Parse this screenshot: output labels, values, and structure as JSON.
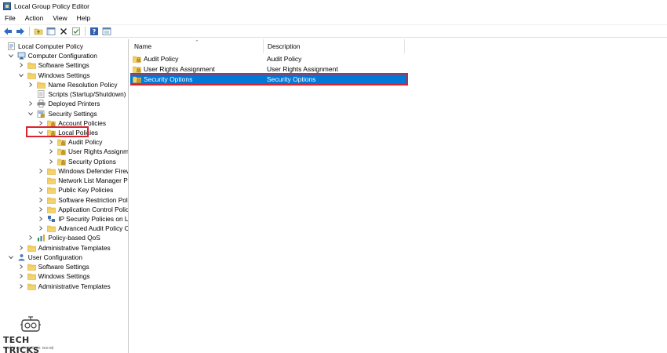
{
  "window": {
    "title": "Local Group Policy Editor"
  },
  "menu": [
    "File",
    "Action",
    "View",
    "Help"
  ],
  "toolbar": {
    "icons": [
      "back-arrow-icon",
      "forward-arrow-icon",
      "up-folder-icon",
      "show-hide-tree-icon",
      "delete-icon",
      "refresh-icon",
      "export-list-icon",
      "help-icon",
      "properties-icon"
    ]
  },
  "tree": [
    {
      "label": "Local Computer Policy",
      "icon": "policy-icon",
      "level": 0,
      "twisty": "none"
    },
    {
      "label": "Computer Configuration",
      "icon": "computer-icon",
      "level": 1,
      "twisty": "open"
    },
    {
      "label": "Software Settings",
      "icon": "folder-icon",
      "level": 2,
      "twisty": "closed"
    },
    {
      "label": "Windows Settings",
      "icon": "folder-icon",
      "level": 2,
      "twisty": "open"
    },
    {
      "label": "Name Resolution Policy",
      "icon": "folder-icon",
      "level": 3,
      "twisty": "closed"
    },
    {
      "label": "Scripts (Startup/Shutdown)",
      "icon": "script-icon",
      "level": 3,
      "twisty": "none"
    },
    {
      "label": "Deployed Printers",
      "icon": "printer-icon",
      "level": 3,
      "twisty": "closed"
    },
    {
      "label": "Security Settings",
      "icon": "security-icon",
      "level": 3,
      "twisty": "open"
    },
    {
      "label": "Account Policies",
      "icon": "locked-folder-icon",
      "level": 4,
      "twisty": "closed"
    },
    {
      "label": "Local Policies",
      "icon": "locked-folder-icon",
      "level": 4,
      "twisty": "open",
      "highlight": true
    },
    {
      "label": "Audit Policy",
      "icon": "locked-folder-icon",
      "level": 5,
      "twisty": "closed"
    },
    {
      "label": "User Rights Assignmer",
      "icon": "locked-folder-icon",
      "level": 5,
      "twisty": "closed"
    },
    {
      "label": "Security Options",
      "icon": "locked-folder-icon",
      "level": 5,
      "twisty": "closed"
    },
    {
      "label": "Windows Defender Firewa",
      "icon": "folder-icon",
      "level": 4,
      "twisty": "closed"
    },
    {
      "label": "Network List Manager Pol",
      "icon": "folder-icon",
      "level": 4,
      "twisty": "none"
    },
    {
      "label": "Public Key Policies",
      "icon": "folder-icon",
      "level": 4,
      "twisty": "closed"
    },
    {
      "label": "Software Restriction Polic",
      "icon": "folder-icon",
      "level": 4,
      "twisty": "closed"
    },
    {
      "label": "Application Control Polici",
      "icon": "folder-icon",
      "level": 4,
      "twisty": "closed"
    },
    {
      "label": "IP Security Policies on Loc",
      "icon": "ipsec-icon",
      "level": 4,
      "twisty": "closed"
    },
    {
      "label": "Advanced Audit Policy Co",
      "icon": "folder-icon",
      "level": 4,
      "twisty": "closed"
    },
    {
      "label": "Policy-based QoS",
      "icon": "qos-chart-icon",
      "level": 3,
      "twisty": "closed"
    },
    {
      "label": "Administrative Templates",
      "icon": "folder-icon",
      "level": 2,
      "twisty": "closed"
    },
    {
      "label": "User Configuration",
      "icon": "user-icon",
      "level": 1,
      "twisty": "open"
    },
    {
      "label": "Software Settings",
      "icon": "folder-icon",
      "level": 2,
      "twisty": "closed"
    },
    {
      "label": "Windows Settings",
      "icon": "folder-icon",
      "level": 2,
      "twisty": "closed"
    },
    {
      "label": "Administrative Templates",
      "icon": "folder-icon",
      "level": 2,
      "twisty": "closed"
    }
  ],
  "list": {
    "columns": [
      "Name",
      "Description"
    ],
    "rows": [
      {
        "name": "Audit Policy",
        "description": "Audit Policy",
        "selected": false
      },
      {
        "name": "User Rights Assignment",
        "description": "User Rights Assignment",
        "selected": false
      },
      {
        "name": "Security Options",
        "description": "Security Options",
        "selected": true
      }
    ]
  },
  "watermark": {
    "title": "TECH TRICKS",
    "subtitle": "THỦ THUẬT CÔNG NGHỆ"
  },
  "colors": {
    "selection": "#0078d7",
    "highlight_border": "#d9232e",
    "folder": "#f3d36b",
    "folder_edge": "#d9a93a"
  }
}
